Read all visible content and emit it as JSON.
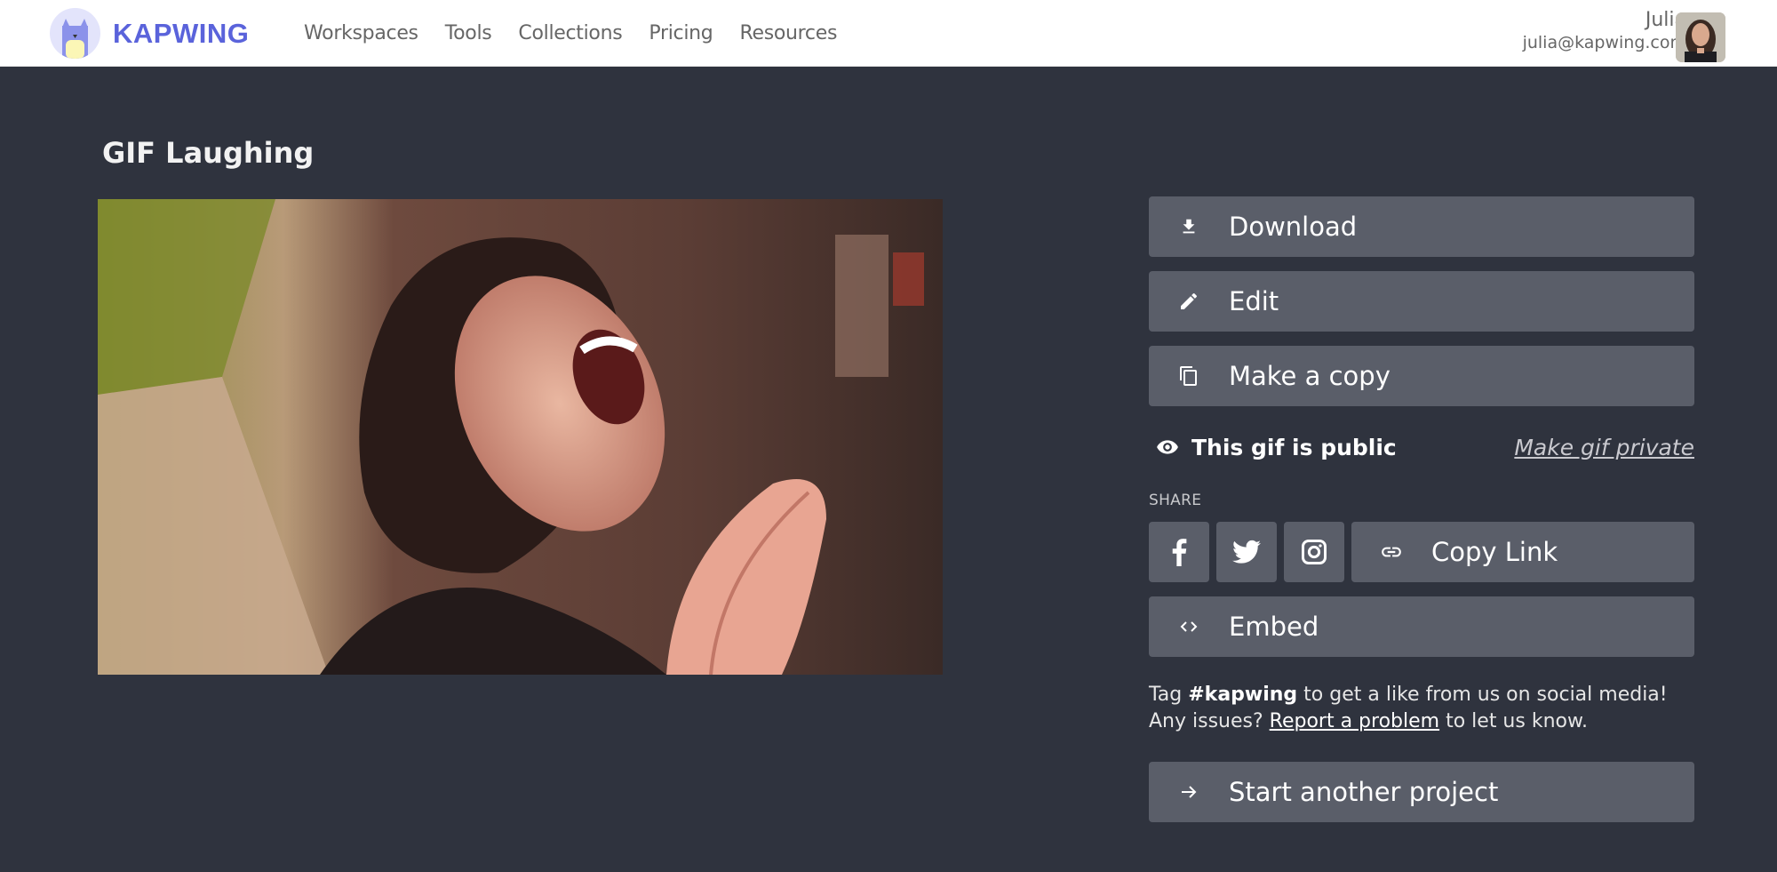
{
  "header": {
    "brand": "KAPWING",
    "nav": [
      "Workspaces",
      "Tools",
      "Collections",
      "Pricing",
      "Resources"
    ],
    "user": {
      "name": "Julia",
      "email": "julia@kapwing.com"
    }
  },
  "page": {
    "title": "GIF Laughing",
    "media_alt": "Woman laughing hysterically and clapping hands"
  },
  "actions": {
    "download": "Download",
    "edit": "Edit",
    "copy": "Make a copy"
  },
  "visibility": {
    "status": "This gif is public",
    "toggle_link": "Make gif private"
  },
  "share": {
    "label": "SHARE",
    "copy_link": "Copy Link",
    "embed": "Embed"
  },
  "info": {
    "tag_prefix": "Tag ",
    "hashtag": "#kapwing",
    "tag_suffix": " to get a like from us on social media! Any issues? ",
    "report_link": "Report a problem",
    "report_suffix": " to let us know."
  },
  "footer_action": {
    "start": "Start another project"
  },
  "colors": {
    "brand": "#5a63db",
    "background": "#2f333e",
    "button": "#5a5e69"
  }
}
